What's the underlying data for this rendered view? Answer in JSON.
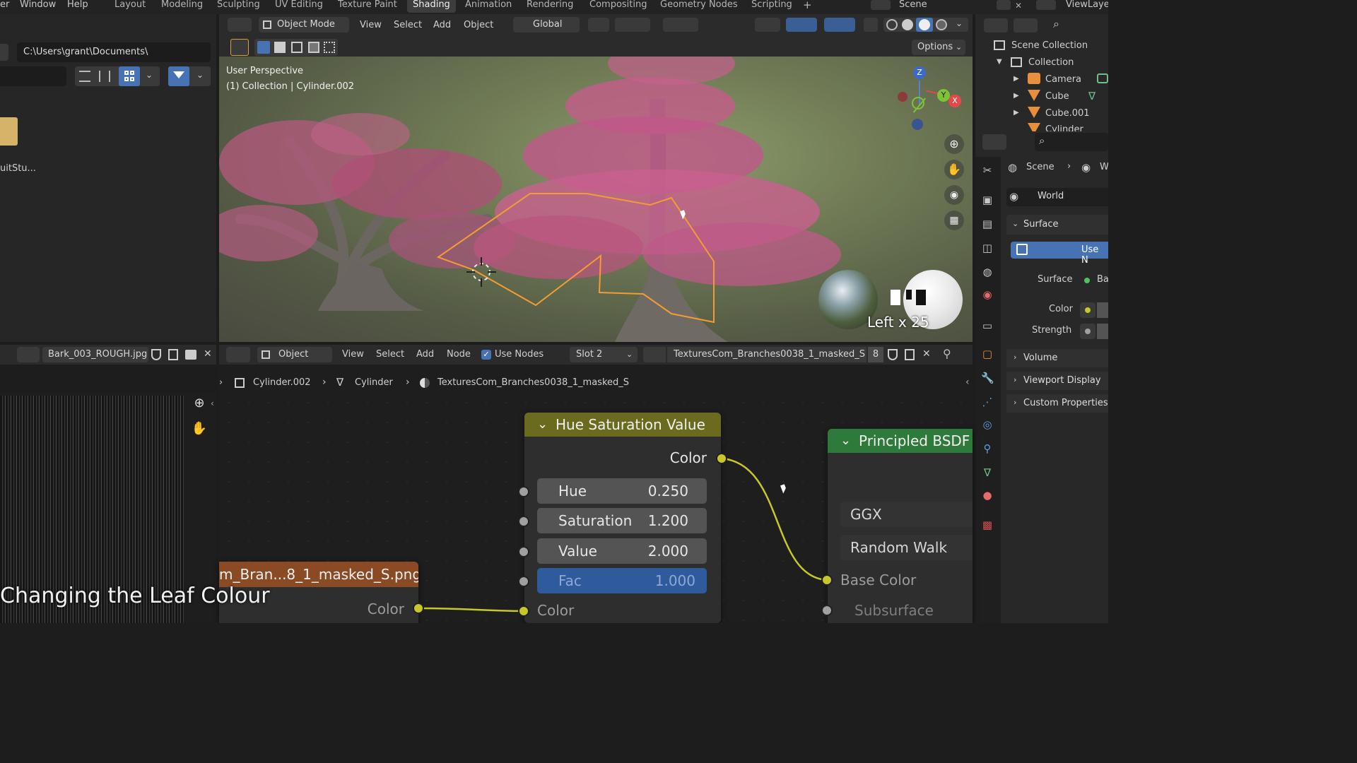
{
  "menu": {
    "items": [
      "er",
      "Window",
      "Help"
    ]
  },
  "workspaces": {
    "tabs": [
      "Layout",
      "Modeling",
      "Sculpting",
      "UV Editing",
      "Texture Paint",
      "Shading",
      "Animation",
      "Rendering",
      "Compositing",
      "Geometry Nodes",
      "Scripting"
    ],
    "active": "Shading",
    "add": "+"
  },
  "scene": {
    "name": "Scene",
    "view_layer": "ViewLaye"
  },
  "file_browser": {
    "path": "C:\\Users\\grant\\Documents\\",
    "folder_label": "uitStu..."
  },
  "viewport": {
    "mode": "Object Mode",
    "menus": [
      "View",
      "Select",
      "Add",
      "Object"
    ],
    "transform": "Global",
    "options": "Options",
    "info_line1": "User Perspective",
    "info_line2": "(1) Collection | Cylinder.002",
    "overlay_text": "Left x 25",
    "gizmo": {
      "z": "Z",
      "y": "Y",
      "x": "X"
    }
  },
  "outliner": {
    "scene_collection": "Scene Collection",
    "collection": "Collection",
    "items": [
      "Camera",
      "Cube",
      "Cube.001",
      "Cylinder"
    ]
  },
  "properties": {
    "scene": "Scene",
    "world_short": "W",
    "world": "World",
    "surface_section": "Surface",
    "use_nodes_btn": "Use N",
    "surface_label": "Surface",
    "surface_value": "Ba",
    "color_label": "Color",
    "strength_label": "Strength",
    "sections": [
      "Volume",
      "Viewport Display",
      "Custom Properties"
    ]
  },
  "image_editor": {
    "image_name": "Bark_003_ROUGH.jpg"
  },
  "node_editor": {
    "object_mode": "Object",
    "menus": [
      "View",
      "Select",
      "Add",
      "Node"
    ],
    "use_nodes": "Use Nodes",
    "slot": "Slot 2",
    "material": "TexturesCom_Branches0038_1_masked_S",
    "user_count": "8",
    "breadcrumb": [
      "Cylinder.002",
      "Cylinder",
      "TexturesCom_Branches0038_1_masked_S"
    ]
  },
  "hsv_node": {
    "title": "Hue Saturation Value",
    "out_label": "Color",
    "fields": [
      {
        "label": "Hue",
        "value": "0.250"
      },
      {
        "label": "Saturation",
        "value": "1.200"
      },
      {
        "label": "Value",
        "value": "2.000"
      },
      {
        "label": "Fac",
        "value": "1.000"
      }
    ],
    "in_color": "Color"
  },
  "bsdf_node": {
    "title": "Principled BSDF",
    "distribution": "GGX",
    "subsurface_method": "Random Walk",
    "base_color": "Base Color",
    "subsurface": "Subsurface"
  },
  "image_node": {
    "title": "m_Bran...8_1_masked_S.png",
    "out_label": "Color"
  },
  "caption": "Changing the Leaf Colour",
  "colors": {
    "accent_blue": "#3f6fb5",
    "hsv_header": "#6b6b1f",
    "bsdf_header": "#2e7a3b",
    "socket_yellow": "#c7c729",
    "selection_orange": "#f39c34"
  }
}
